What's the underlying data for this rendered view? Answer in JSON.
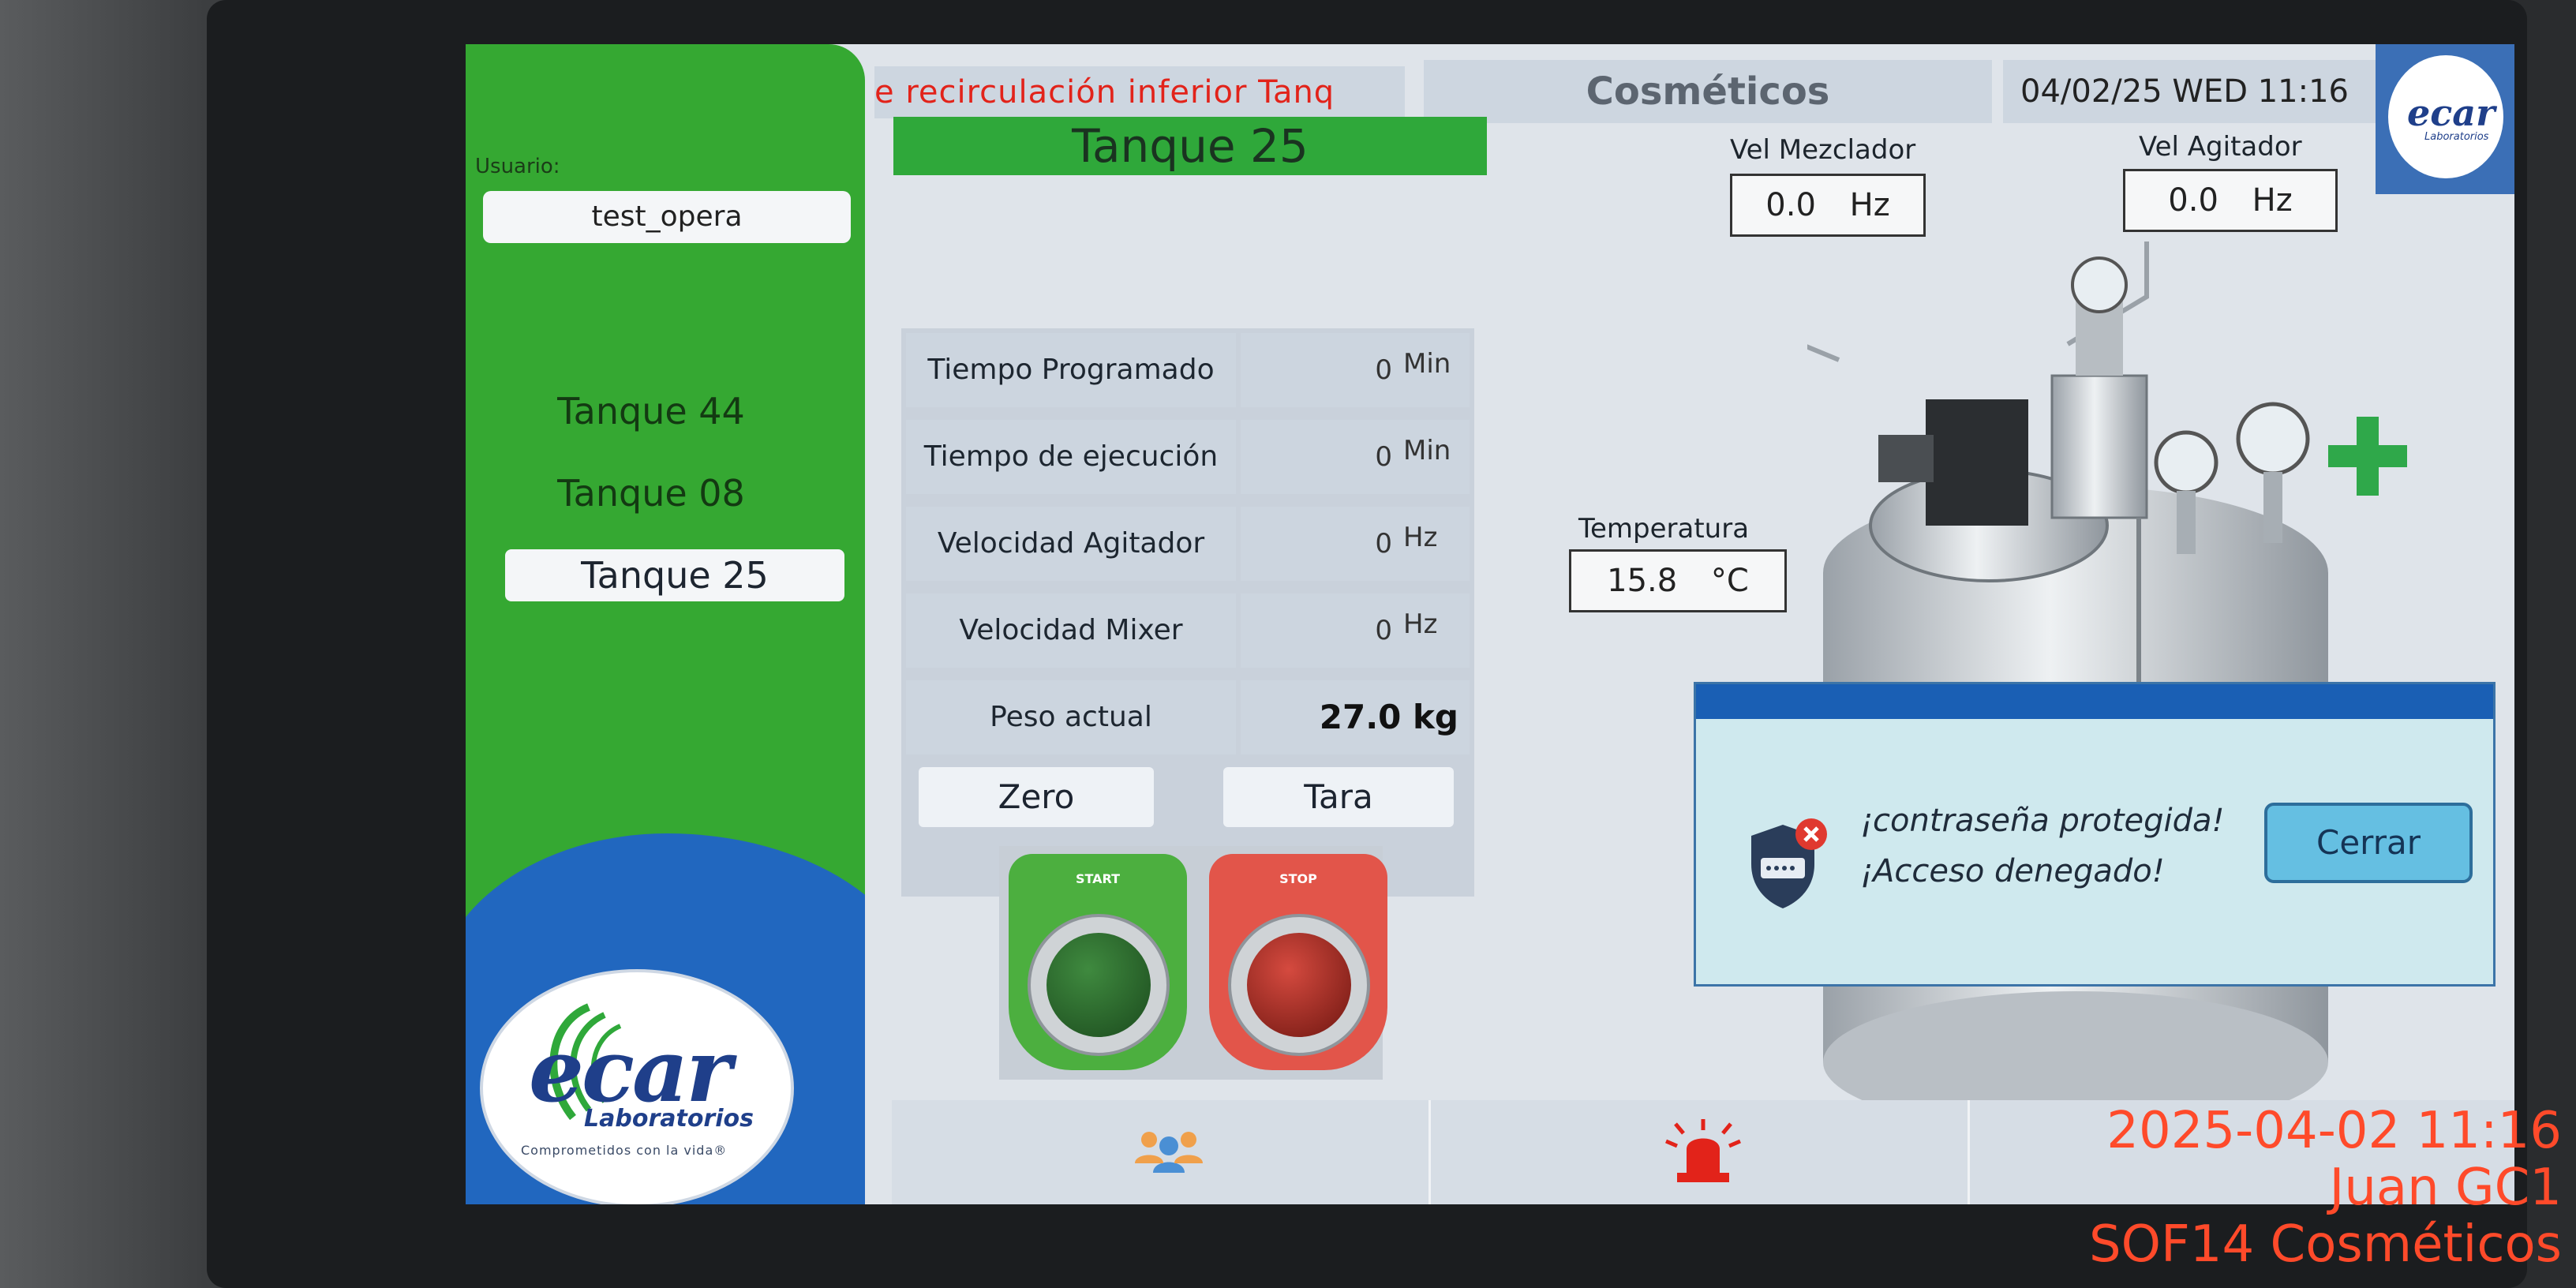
{
  "header": {
    "marquee": "e recirculación inferior Tanq",
    "section": "Cosméticos",
    "datetime": "04/02/25 WED 11:16",
    "logo_text": "ecar",
    "logo_sub": "Laboratorios"
  },
  "sidebar": {
    "user_label": "Usuario:",
    "user_value": "test_opera",
    "tanks": [
      {
        "label": "Tanque 44",
        "active": false
      },
      {
        "label": "Tanque 08",
        "active": false
      },
      {
        "label": "Tanque 25",
        "active": true
      }
    ],
    "logo_text": "ecar",
    "logo_sub": "Laboratorios",
    "logo_tagline": "Comprometidos con la vida®"
  },
  "tank_title": "Tanque 25",
  "table": {
    "rows": [
      {
        "label": "Tiempo Programado",
        "value": "0",
        "unit": "Min"
      },
      {
        "label": "Tiempo de ejecución",
        "value": "0",
        "unit": "Min"
      },
      {
        "label": "Velocidad Agitador",
        "value": "0",
        "unit": "Hz"
      },
      {
        "label": "Velocidad Mixer",
        "value": "0",
        "unit": "Hz"
      },
      {
        "label": "Peso actual",
        "value": "27.0 kg",
        "unit": ""
      }
    ],
    "zero_label": "Zero",
    "tara_label": "Tara"
  },
  "controls": {
    "start_label": "START",
    "stop_label": "STOP"
  },
  "gauges": {
    "mezclador_label": "Vel Mezclador",
    "mezclador_value": "0.0",
    "mezclador_unit": "Hz",
    "agitador_label": "Vel Agitador",
    "agitador_value": "0.0",
    "agitador_unit": "Hz",
    "temp_label": "Temperatura",
    "temp_value": "15.8",
    "temp_unit": "°C"
  },
  "dialog": {
    "line1": "¡contraseña protegida!",
    "line2": "¡Acceso denegado!",
    "close_label": "Cerrar"
  },
  "overlay": {
    "timestamp": "2025-04-02 11:16",
    "name": "Juan GC1",
    "place": "SOF14 Cosméticos"
  },
  "colors": {
    "sidebar_green": "#35a832",
    "sidebar_blue": "#2167bf",
    "alarm_red": "#e2231a",
    "dialog_bar": "#1a5fb4",
    "overlay_text": "#ff4a2a"
  }
}
